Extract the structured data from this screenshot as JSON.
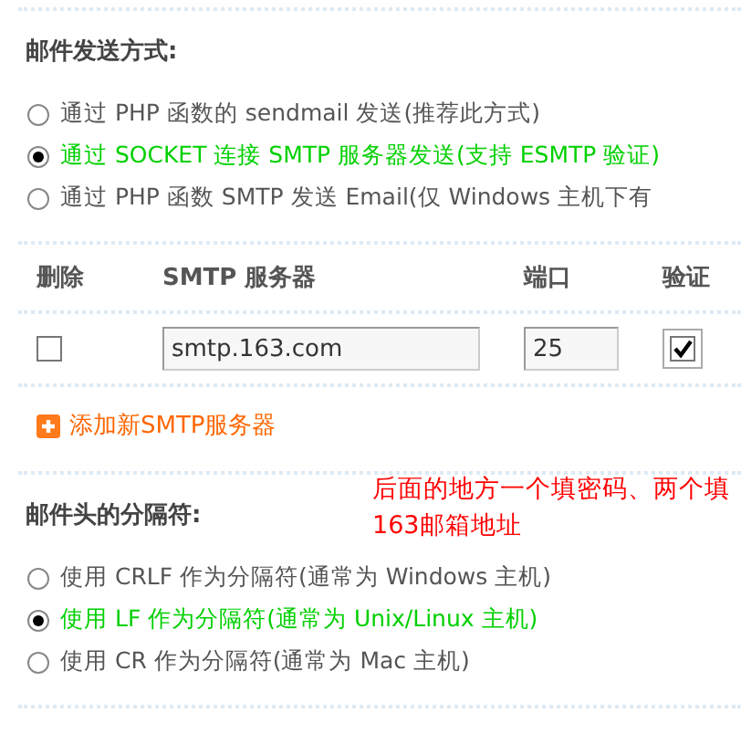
{
  "send_method": {
    "heading": "邮件发送方式:",
    "options": [
      {
        "label": "通过 PHP 函数的 sendmail 发送(推荐此方式)",
        "selected": false
      },
      {
        "label": "通过 SOCKET 连接 SMTP 服务器发送(支持 ESMTP 验证)",
        "selected": true
      },
      {
        "label": "通过 PHP 函数 SMTP 发送 Email(仅 Windows 主机下有",
        "selected": false
      }
    ]
  },
  "smtp_table": {
    "columns": [
      "删除",
      "SMTP 服务器",
      "端口",
      "验证"
    ],
    "rows": [
      {
        "delete": false,
        "server": "smtp.163.com",
        "port": "25",
        "auth": true
      }
    ],
    "add_link": "添加新SMTP服务器"
  },
  "annotation": "后面的地方一个填密码、两个填163邮箱地址",
  "header_separator": {
    "heading": "邮件头的分隔符:",
    "options": [
      {
        "label": "使用 CRLF 作为分隔符(通常为 Windows 主机)",
        "selected": false
      },
      {
        "label": "使用 LF 作为分隔符(通常为 Unix/Linux 主机)",
        "selected": true
      },
      {
        "label": "使用 CR 作为分隔符(通常为 Mac 主机)",
        "selected": false
      }
    ]
  }
}
